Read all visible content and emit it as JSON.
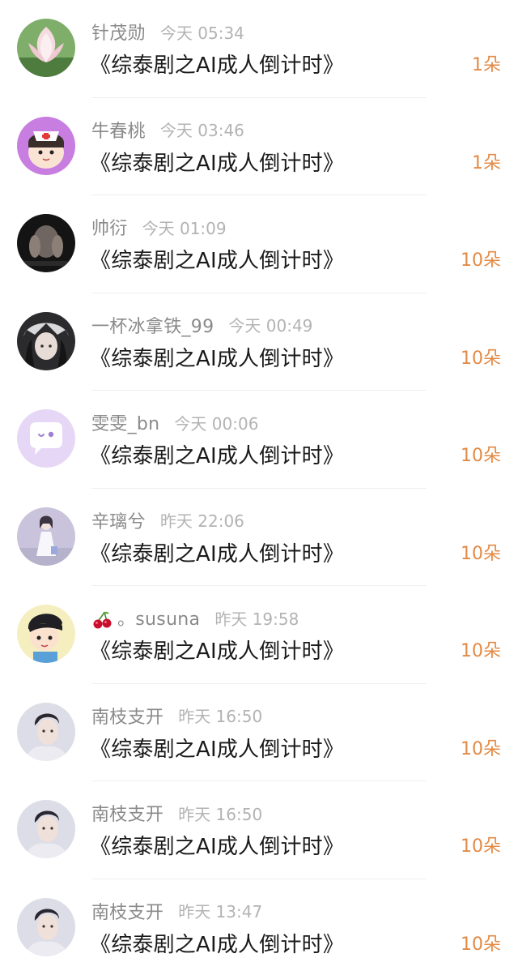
{
  "items": [
    {
      "name": "针茂勋",
      "time": "今天 05:34",
      "title": "《综泰剧之AI成人倒计时》",
      "gift": "1朵",
      "avatar": "lotus-flower-avatar"
    },
    {
      "name": "牛春桃",
      "time": "今天 03:46",
      "title": "《综泰剧之AI成人倒计时》",
      "gift": "1朵",
      "avatar": "nurse-cartoon-avatar"
    },
    {
      "name": "帅衍",
      "time": "今天 01:09",
      "title": "《综泰剧之AI成人倒计时》",
      "gift": "10朵",
      "avatar": "dark-portrait-avatar"
    },
    {
      "name": "一杯冰拿铁_99",
      "time": "今天 00:49",
      "title": "《综泰剧之AI成人倒计时》",
      "gift": "10朵",
      "avatar": "dark-fantasy-girl-avatar"
    },
    {
      "name": "雯雯_bn",
      "time": "今天 00:06",
      "title": "《综泰剧之AI成人倒计时》",
      "gift": "10朵",
      "avatar": "purple-chat-bubble-avatar"
    },
    {
      "name": "辛璃兮",
      "time": "昨天 22:06",
      "title": "《综泰剧之AI成人倒计时》",
      "gift": "10朵",
      "avatar": "anime-girl-white-dress-avatar"
    },
    {
      "name": "。susuna",
      "time": "昨天 19:58",
      "title": "《综泰剧之AI成人倒计时》",
      "gift": "10朵",
      "avatar": "cartoon-boy-avatar",
      "prefix_icon": "cherry-icon"
    },
    {
      "name": "南枝支开",
      "time": "昨天 16:50",
      "title": "《综泰剧之AI成人倒计时》",
      "gift": "10朵",
      "avatar": "male-portrait-avatar"
    },
    {
      "name": "南枝支开",
      "time": "昨天 16:50",
      "title": "《综泰剧之AI成人倒计时》",
      "gift": "10朵",
      "avatar": "male-portrait-avatar"
    },
    {
      "name": "南枝支开",
      "time": "昨天 13:47",
      "title": "《综泰剧之AI成人倒计时》",
      "gift": "10朵",
      "avatar": "male-portrait-avatar"
    }
  ],
  "colors": {
    "name": "#8a8a8a",
    "time": "#b3b3b3",
    "title": "#1a1a1a",
    "gift": "#e38a45",
    "divider": "#efefef"
  }
}
